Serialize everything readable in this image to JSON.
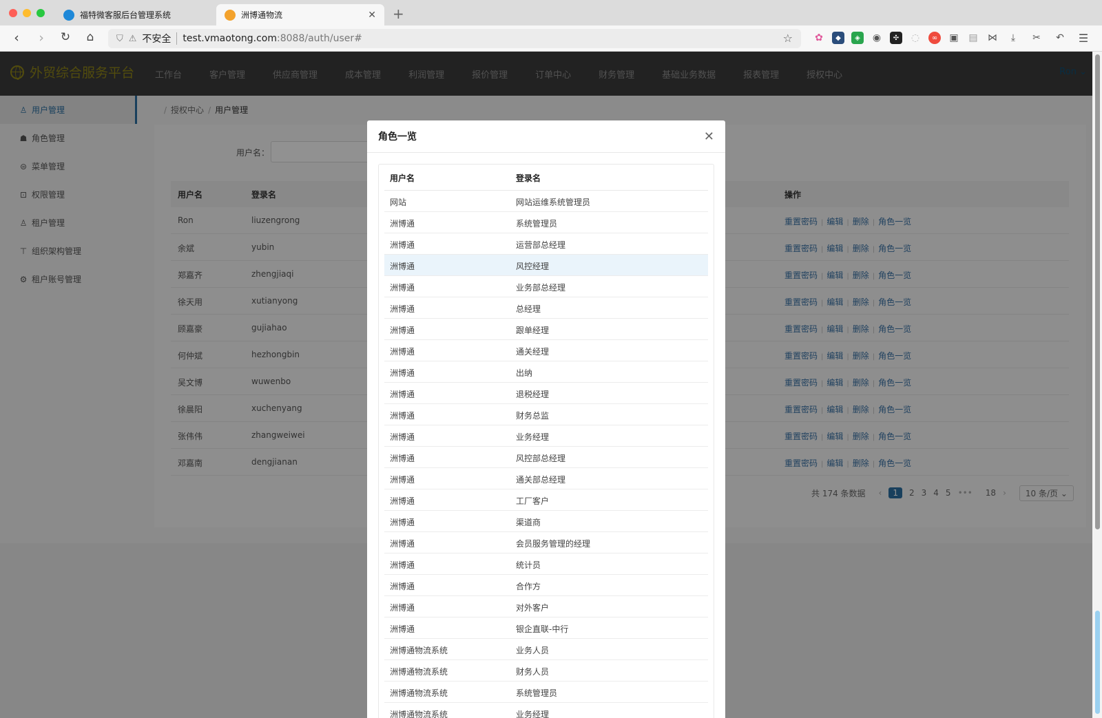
{
  "browser": {
    "tabs": [
      {
        "title": "福特微客服后台管理系统",
        "color": "#1e88d8"
      },
      {
        "title": "洲博通物流",
        "color": "#f3a22c"
      }
    ],
    "url": {
      "insecure_label": "不安全",
      "host": "test.vmaotong.com",
      "path": ":8088/auth/user#"
    }
  },
  "app": {
    "title": "外贸综合服务平台",
    "user": "Ron",
    "nav": [
      "工作台",
      "客户管理",
      "供应商管理",
      "成本管理",
      "利润管理",
      "报价管理",
      "订单中心",
      "财务管理",
      "基础业务数据",
      "报表管理",
      "授权中心"
    ]
  },
  "sidebar": {
    "items": [
      {
        "label": "用户管理",
        "icon": "user-icon"
      },
      {
        "label": "角色管理",
        "icon": "graduation-cap-icon"
      },
      {
        "label": "菜单管理",
        "icon": "menu-list-icon"
      },
      {
        "label": "权限管理",
        "icon": "lock-icon"
      },
      {
        "label": "租户管理",
        "icon": "tenant-user-icon"
      },
      {
        "label": "组织架构管理",
        "icon": "org-chart-icon"
      },
      {
        "label": "租户账号管理",
        "icon": "account-gear-icon"
      }
    ]
  },
  "breadcrumb": [
    "授权中心",
    "用户管理"
  ],
  "filter": {
    "label": "用户名："
  },
  "users": {
    "headers": {
      "name": "用户名",
      "login": "登录名",
      "ops": "操作"
    },
    "ops": [
      "重置密码",
      "编辑",
      "删除",
      "角色一览"
    ],
    "rows": [
      {
        "name": "Ron",
        "login": "liuzengrong"
      },
      {
        "name": "余斌",
        "login": "yubin"
      },
      {
        "name": "郑嘉齐",
        "login": "zhengjiaqi"
      },
      {
        "name": "徐天用",
        "login": "xutianyong"
      },
      {
        "name": "顾嘉豪",
        "login": "gujiahao"
      },
      {
        "name": "何仲斌",
        "login": "hezhongbin"
      },
      {
        "name": "吴文博",
        "login": "wuwenbo"
      },
      {
        "name": "徐晨阳",
        "login": "xuchenyang"
      },
      {
        "name": "张伟伟",
        "login": "zhangweiwei"
      },
      {
        "name": "邓嘉南",
        "login": "dengjianan"
      }
    ]
  },
  "pagination": {
    "total": "共 174 条数据",
    "prev": "‹",
    "pages": [
      "1",
      "2",
      "3",
      "4",
      "5"
    ],
    "ellipsis": "•••",
    "last": "18",
    "next": "›",
    "size": "10 条/页"
  },
  "modal": {
    "title": "角色一览",
    "headers": {
      "name": "用户名",
      "login": "登录名"
    },
    "rows": [
      {
        "name": "网站",
        "login": "网站运维系统管理员"
      },
      {
        "name": "洲博通",
        "login": "系统管理员"
      },
      {
        "name": "洲博通",
        "login": "运营部总经理"
      },
      {
        "name": "洲博通",
        "login": "风控经理"
      },
      {
        "name": "洲博通",
        "login": "业务部总经理"
      },
      {
        "name": "洲博通",
        "login": "总经理"
      },
      {
        "name": "洲博通",
        "login": "跟单经理"
      },
      {
        "name": "洲博通",
        "login": "通关经理"
      },
      {
        "name": "洲博通",
        "login": "出纳"
      },
      {
        "name": "洲博通",
        "login": "退税经理"
      },
      {
        "name": "洲博通",
        "login": "财务总监"
      },
      {
        "name": "洲博通",
        "login": "业务经理"
      },
      {
        "name": "洲博通",
        "login": "风控部总经理"
      },
      {
        "name": "洲博通",
        "login": "通关部总经理"
      },
      {
        "name": "洲博通",
        "login": "工厂客户"
      },
      {
        "name": "洲博通",
        "login": "渠道商"
      },
      {
        "name": "洲博通",
        "login": "会员服务管理的经理"
      },
      {
        "name": "洲博通",
        "login": "统计员"
      },
      {
        "name": "洲博通",
        "login": "合作方"
      },
      {
        "name": "洲博通",
        "login": "对外客户"
      },
      {
        "name": "洲博通",
        "login": "银企直联-中行"
      },
      {
        "name": "洲博通物流系统",
        "login": "业务人员"
      },
      {
        "name": "洲博通物流系统",
        "login": "财务人员"
      },
      {
        "name": "洲博通物流系统",
        "login": "系统管理员"
      },
      {
        "name": "洲博通物流系统",
        "login": "业务经理"
      }
    ]
  }
}
